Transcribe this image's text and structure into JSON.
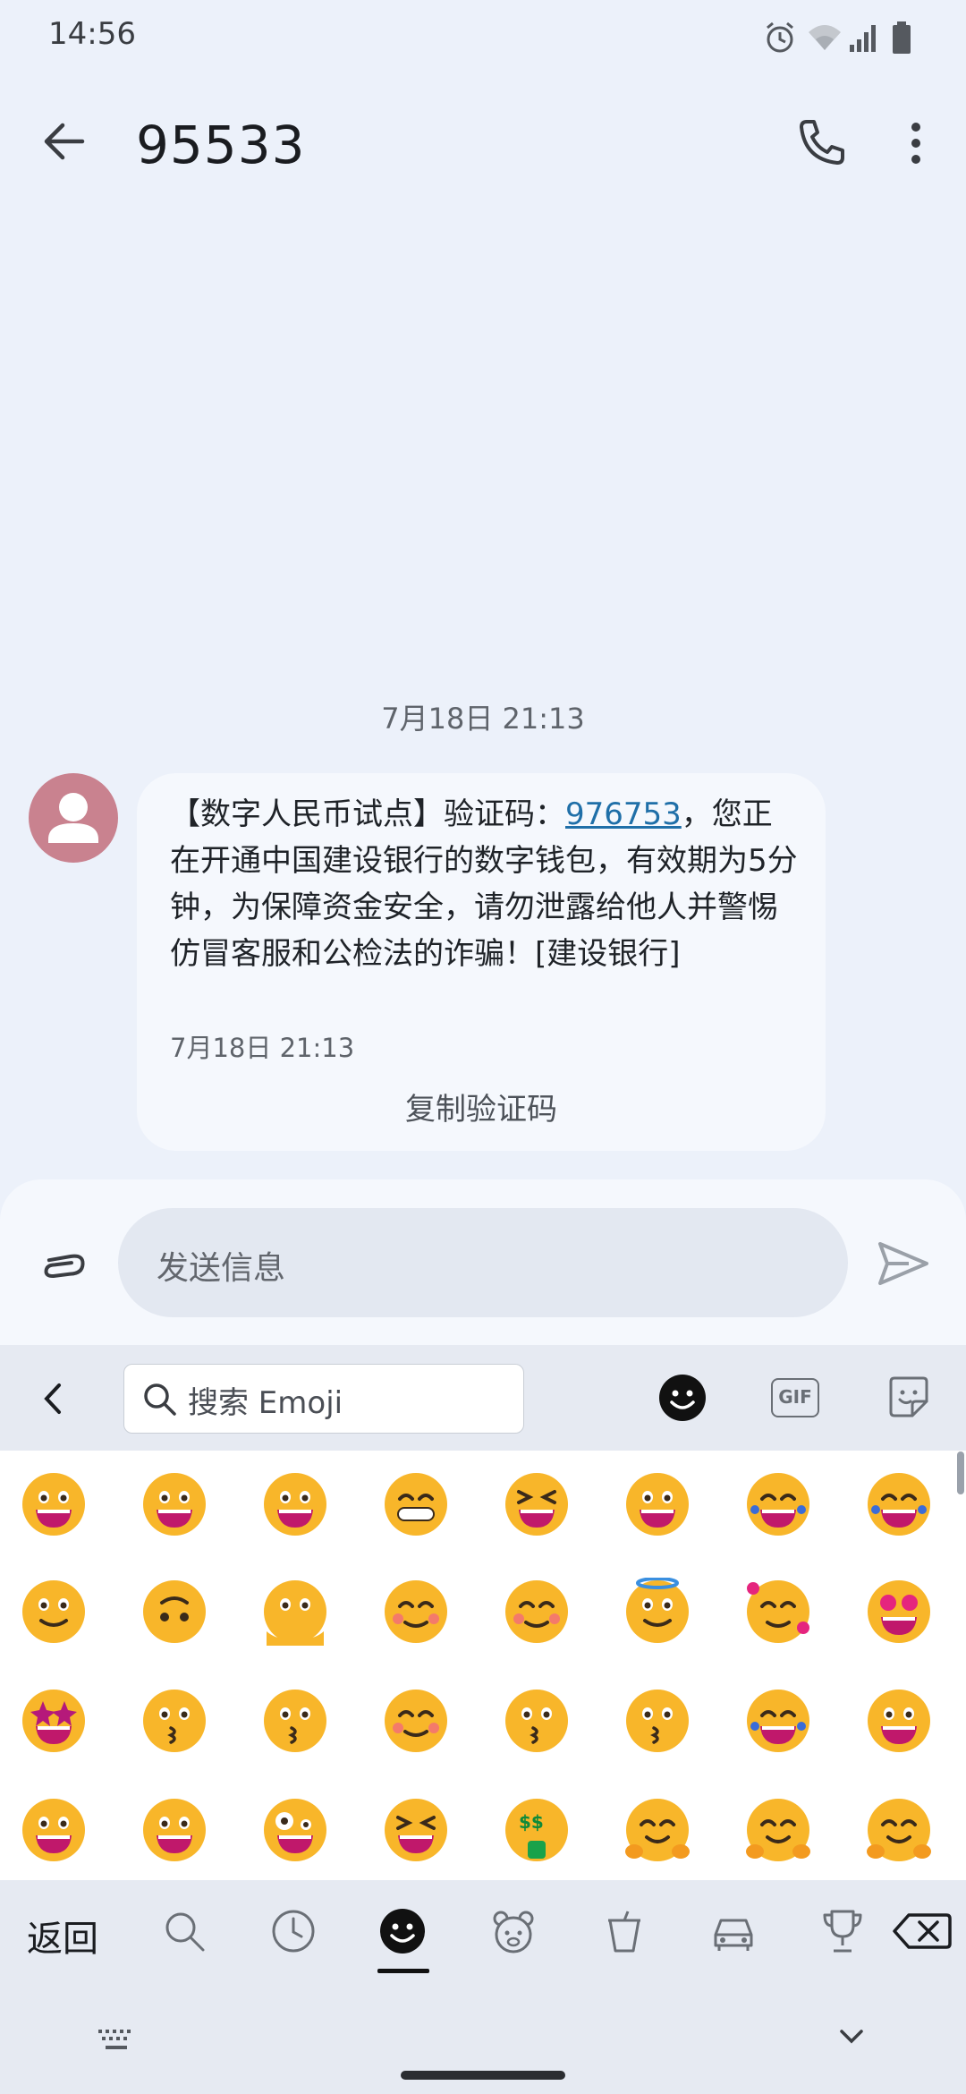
{
  "status_bar": {
    "time": "14:56"
  },
  "header": {
    "title": "95533"
  },
  "conversation": {
    "date_label": "7月18日 21:13",
    "message": {
      "text_before": "【数字人民币试点】验证码：",
      "code": "976753",
      "text_after": "，您正在开通中国建设银行的数字钱包，有效期为5分钟，为保障资金安全，请勿泄露给他人并警惕仿冒客服和公检法的诈骗！[建设银行]",
      "time": "7月18日 21:13",
      "copy_action": "复制验证码"
    }
  },
  "compose": {
    "placeholder": "发送信息"
  },
  "keyboard": {
    "search_placeholder": "搜索 Emoji",
    "gif_label": "GIF",
    "back_label": "返回"
  },
  "colors": {
    "avatar": "#c9828f",
    "code_link": "#1f6fa8",
    "emoji_yellow": "#f8b62a"
  }
}
